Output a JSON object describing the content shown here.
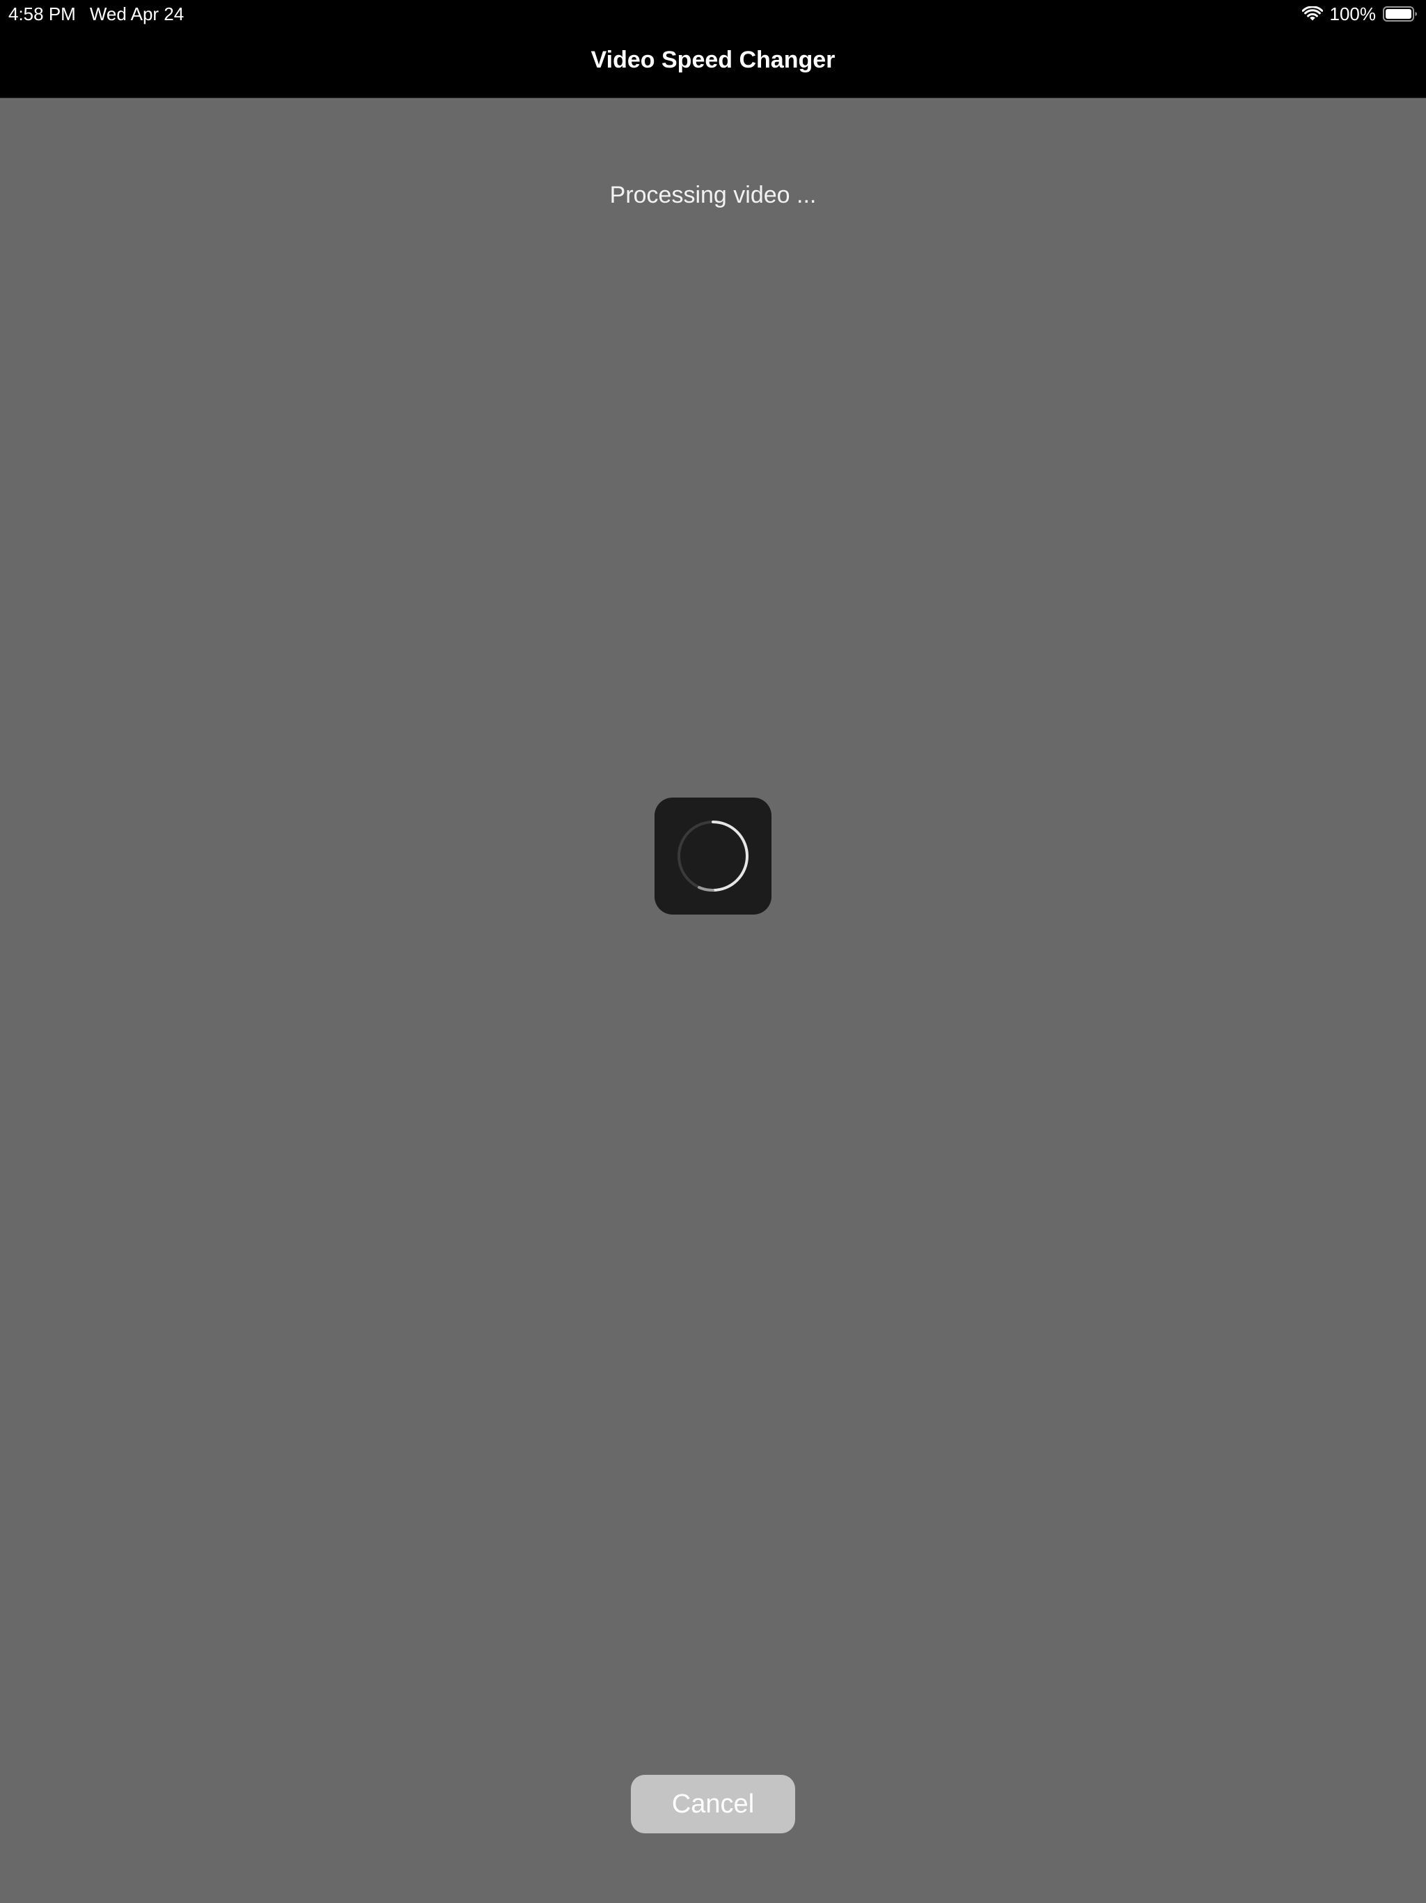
{
  "status_bar": {
    "time": "4:58 PM",
    "date": "Wed Apr 24",
    "battery_percent": "100%",
    "wifi_icon": "wifi-icon",
    "battery_icon": "battery-icon",
    "battery_level": 1.0
  },
  "nav": {
    "title": "Video Speed Changer"
  },
  "processing": {
    "message": "Processing video ...",
    "spinner_icon": "activity-indicator-icon"
  },
  "actions": {
    "cancel_label": "Cancel"
  },
  "colors": {
    "background": "#696969",
    "bar": "#000000",
    "spinner_box": "#1c1c1c",
    "cancel_button": "#c4c4c4"
  }
}
